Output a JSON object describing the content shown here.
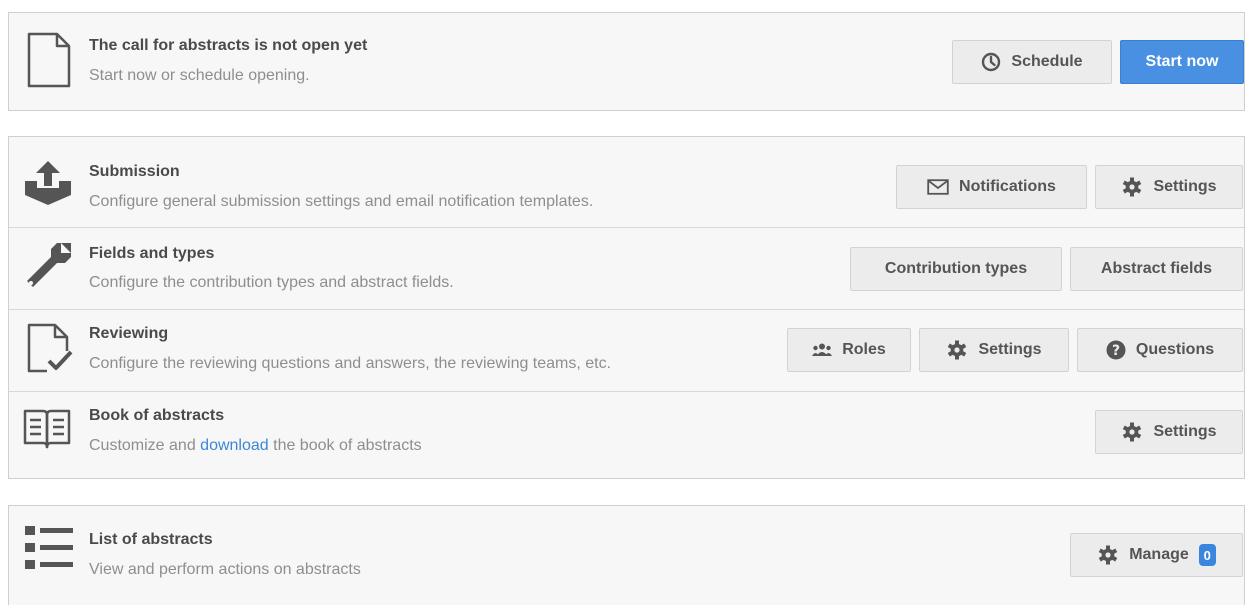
{
  "call_status": {
    "title": "The call for abstracts is not open yet",
    "subtitle": "Start now or schedule opening.",
    "schedule_label": "Schedule",
    "start_label": "Start now",
    "icon": "file-icon"
  },
  "sections": {
    "submission": {
      "title": "Submission",
      "desc": "Configure general submission settings and email notification templates.",
      "notifications_label": "Notifications",
      "settings_label": "Settings",
      "icon": "upload-icon"
    },
    "fields": {
      "title": "Fields and types",
      "desc": "Configure the contribution types and abstract fields.",
      "contribution_types_label": "Contribution types",
      "abstract_fields_label": "Abstract fields",
      "icon": "wrench-icon"
    },
    "reviewing": {
      "title": "Reviewing",
      "desc": "Configure the reviewing questions and answers, the reviewing teams, etc.",
      "roles_label": "Roles",
      "settings_label": "Settings",
      "questions_label": "Questions",
      "icon": "file-check-icon"
    },
    "book": {
      "title": "Book of abstracts",
      "desc_before": "Customize and ",
      "desc_link": "download",
      "desc_after": " the book of abstracts",
      "settings_label": "Settings",
      "icon": "book-icon"
    }
  },
  "list": {
    "title": "List of abstracts",
    "desc": "View and perform actions on abstracts",
    "manage_label": "Manage",
    "badge_count": "0",
    "icon": "list-icon"
  },
  "colors": {
    "primary": "#4a90e2",
    "link": "#3c87d4",
    "badge": "#3a86df"
  }
}
